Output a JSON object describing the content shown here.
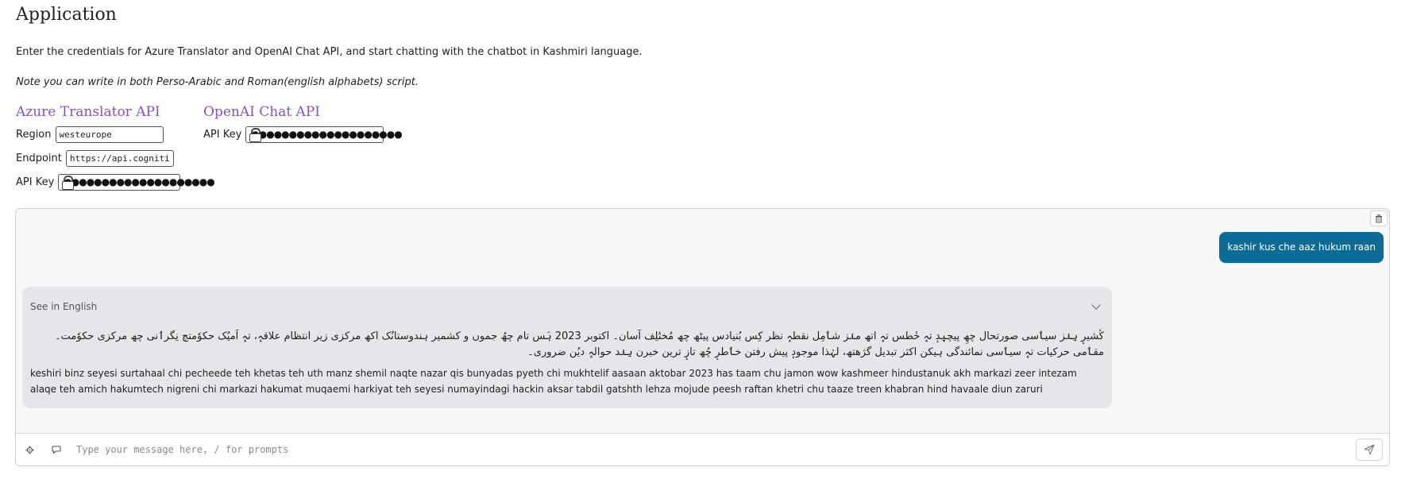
{
  "page": {
    "title": "Application",
    "description": "Enter the credentials for Azure Translator and OpenAI Chat API, and start chatting with the chatbot in Kashmiri language.",
    "note": "Note you can write in both Perso-Arabic and Roman(english alphabets) script."
  },
  "azure": {
    "heading": "Azure Translator API",
    "region_label": "Region",
    "region_value": "westeurope",
    "endpoint_label": "Endpoint",
    "endpoint_value": "https://api.cognitiv",
    "apikey_label": "API Key",
    "apikey_mask": "●●●●●●●●●●●●●●●●●●●●"
  },
  "openai": {
    "heading": "OpenAI Chat API",
    "apikey_label": "API Key",
    "apikey_mask": "●●●●●●●●●●●●●●●●●●●●"
  },
  "chat": {
    "user_message": "kashir kus che aaz hukum raan",
    "bot": {
      "toggle_label": "See in English",
      "kashmiri_text": "کٔشیرٕ ہِنٛز سیٲسی صورتحال چھِ پیچیٖدٕ تہٕ خٔطس تہٕ اتھ منٛز شٲمِل نقطہٕ نظر کِس بُنیادس پیٹھ چھ مُختٔلِف آسان۔ اکتوبر 2023 ہَس تام چھُ جموں و کشمیر ہندوستانُک اکھ مرکزی زیر انتظام علاقہٕ، تہٕ اَمیُک حکوٗمتچ نِگرٲنی چھ مرکزی حکوٗمت۔ مقٲمی حرکیات تہٕ سیٲسی نمائندگی ہیکن اکثر تبدیل گژھتھ، لہٰذا موجودٕ پیش رفتن خٲطرٕ چُھ تازٕ ترین خبرن ہِنٛد حوالہٕ دیُن ضروری۔",
      "roman_text": "keshiri binz seyesi surtahaal chi pecheede teh khetas teh uth manz shemil naqte nazar qis bunyadas pyeth chi mukhtelif aasaan aktobar 2023 has taam chu jamon wow kashmeer hindustanuk akh markazi zeer intezam alaqe teh amich hakumtech nigreni chi markazi hakumat muqaemi harkiyat teh seyesi numayindagi hackin aksar tabdil gatshth lehza mojude peesh raftan khetri chu taaze treen khabran hind havaale diun zaruri"
    },
    "input_placeholder": "Type your message here, / for prompts"
  },
  "colors": {
    "accent_heading": "#8a4fc7",
    "user_bubble": "#0a6c97",
    "bot_bubble": "#e5e5ea"
  }
}
